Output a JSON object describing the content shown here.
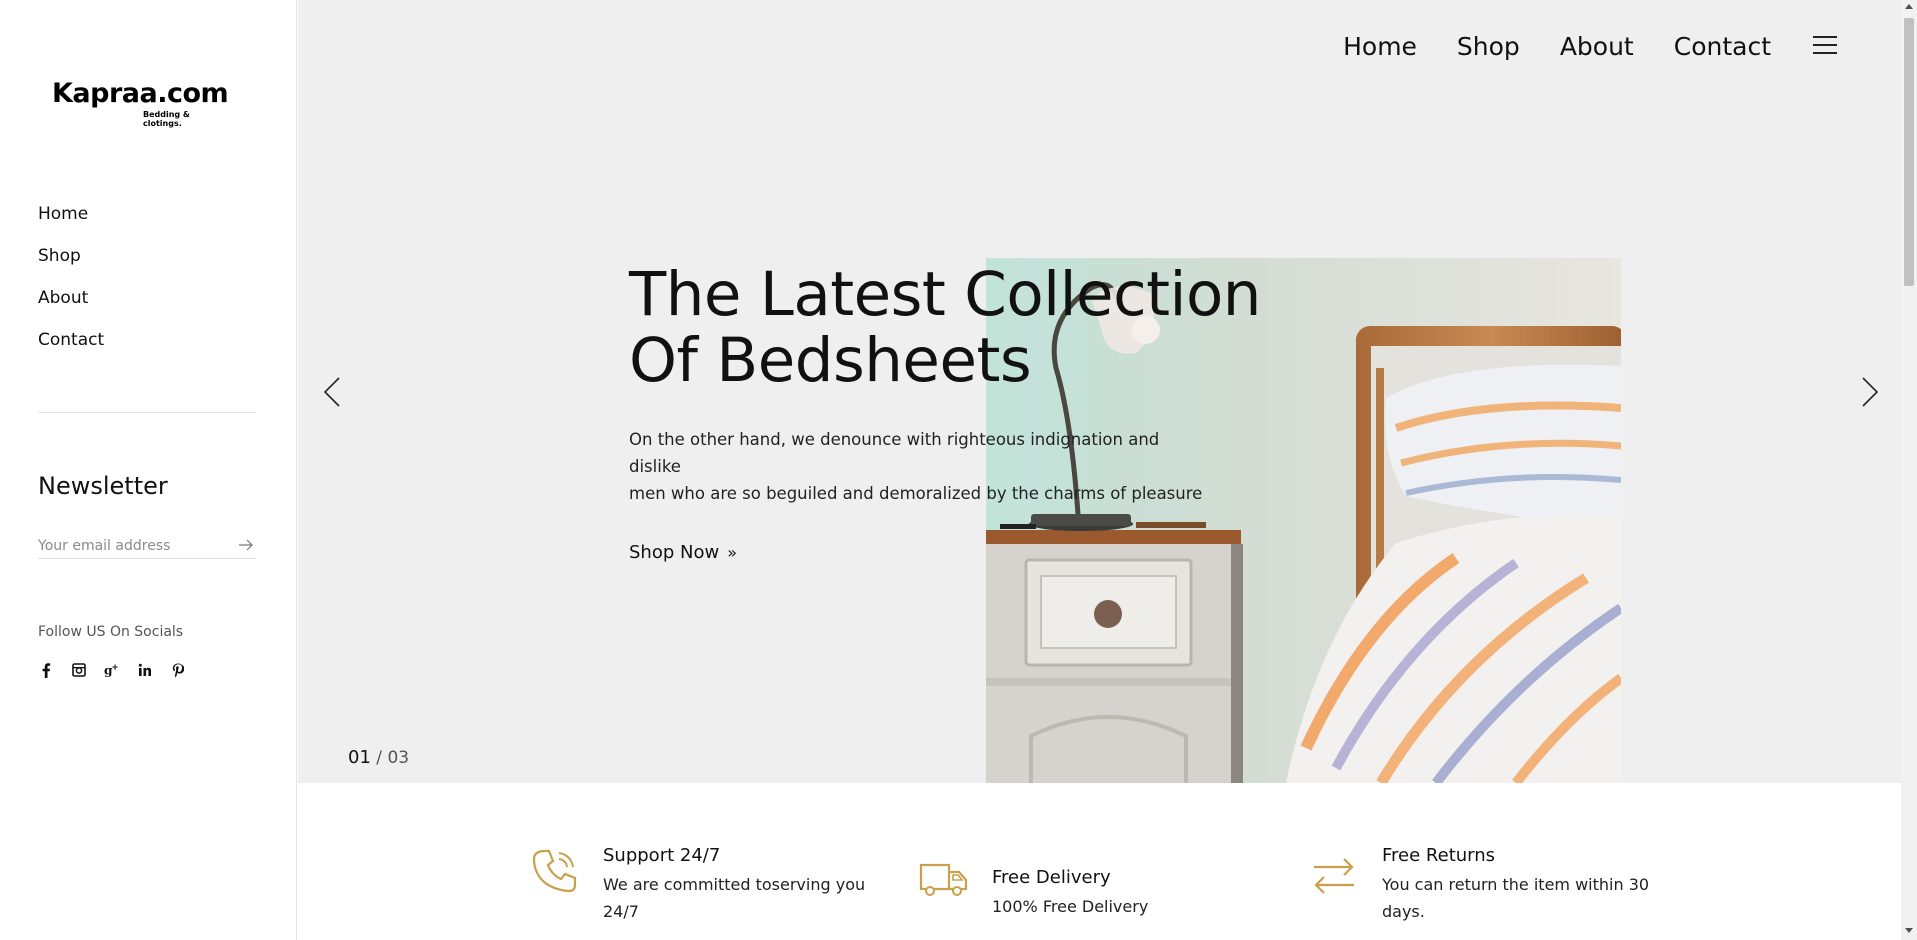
{
  "brand": {
    "name": "Kapraa.com",
    "tagline": "Bedding & clotings."
  },
  "sidebar": {
    "nav": [
      {
        "label": "Home"
      },
      {
        "label": "Shop"
      },
      {
        "label": "About"
      },
      {
        "label": "Contact"
      }
    ],
    "newsletter_title": "Newsletter",
    "email_placeholder": "Your email address",
    "follow_label": "Follow US On Socials",
    "socials": [
      {
        "name": "facebook-icon",
        "glyph": "f"
      },
      {
        "name": "instagram-icon",
        "glyph": ""
      },
      {
        "name": "google-plus-icon",
        "glyph": "g+"
      },
      {
        "name": "linkedin-icon",
        "glyph": "in"
      },
      {
        "name": "pinterest-icon",
        "glyph": "p"
      }
    ]
  },
  "top_nav": [
    {
      "label": "Home"
    },
    {
      "label": "Shop"
    },
    {
      "label": "About"
    },
    {
      "label": "Contact"
    }
  ],
  "hero": {
    "headline_line1": "The Latest Collection",
    "headline_line2": "Of Bedsheets",
    "description_line1": "On the other hand, we denounce with righteous indignation and dislike",
    "description_line2": "men who are so beguiled and demoralized by the charms of pleasure",
    "cta_label": "Shop Now",
    "slide_current": "01",
    "slide_total": "03"
  },
  "features": [
    {
      "icon": "phone-icon",
      "title": "Support 24/7",
      "line1": "We are committed toserving you",
      "line2": "24/7"
    },
    {
      "icon": "truck-icon",
      "title": "Free Delivery",
      "line1": "100% Free Delivery",
      "line2": ""
    },
    {
      "icon": "return-arrows-icon",
      "title": "Free Returns",
      "line1": "You can return the item within 30",
      "line2": "days."
    }
  ],
  "colors": {
    "accent": "#c9a04b",
    "hero_bg": "#efefef",
    "text": "#111111"
  }
}
